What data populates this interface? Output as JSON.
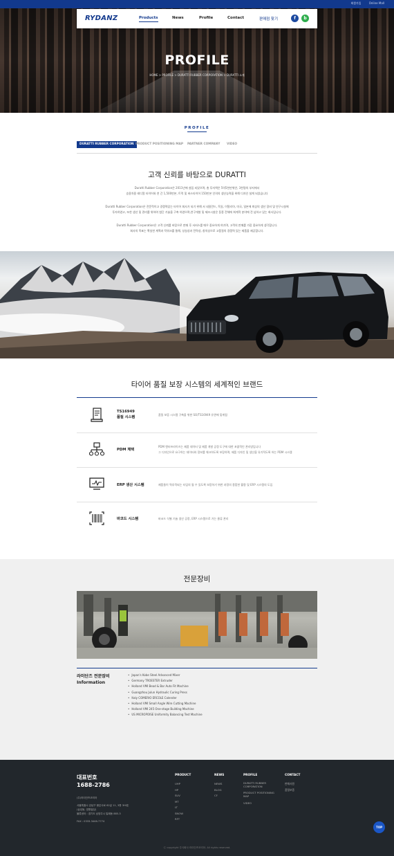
{
  "topbar": {
    "links": [
      "회원가입",
      "Online Mall"
    ]
  },
  "hero": {
    "title": "PROFILE",
    "breadcrumb": "HOME > PROFILE > DURATTI RUBBER CORPORATION > DURATTI 소개"
  },
  "nav": {
    "logo": "RYDANZ",
    "items": [
      "Products",
      "News",
      "Profile",
      "Contact"
    ],
    "agent": "판매점 찾기",
    "social": [
      "f",
      "b"
    ]
  },
  "profile": {
    "label": "PROFILE",
    "tabs": [
      "DURATTI RUBBER CORPORATION",
      "PRODUCT POSITIONING MAP",
      "PARTNER COMPANY",
      "VIDEO"
    ]
  },
  "intro": {
    "title": "고객 신뢰를 바탕으로 DURATTI",
    "p1": [
      "Duratti Rubber Corporation은 2011년에 설립 되었으며, 총 투자액은 5억5천만위안, 3천명의 부지에서",
      "승용차용 레디얼 타이어와 연 간 1,500만본, 트럭 및 버스타이어 150만본 인의의 생산능력을 위해 디자인 설계 되었습니다"
    ],
    "p2": [
      "Duratti Rubber Corporation은 전문적이고 경쟁력있는 타이어 회사가 되기 위해 서 네덜란드, 독일, 이탈리아, 미국, 일본에 최상의 생산 장비 및 연구시설에",
      "투자하였고, 또한 생산 및 관리를 위하여 첨단 기술을 구축 하였으며,연구개발 및 제조시설은 동종 전체에 최계적 분야에 전 넘하고 있는 회사입니다."
    ],
    "p3": [
      "Duratti Rubber Corporation은 고객 신뢰를 바탕으로 판매 후 서비스를 매우 중요하게 여기며, 고객의 판매를 가장 중요하게 생각합니다.",
      "회사의 목표는 확실한 계획과 탁워크를 통해, 성실성과 전략성, 창의성으로 고품질의 경쟁력 있는 제품을 제공합니다."
    ]
  },
  "brand": {
    "title": "타이어 품질 보장 시스템의 세계적인 브랜드",
    "features": [
      {
        "name": [
          "TS16949",
          "품질 시스템"
        ],
        "icon": "document-certificate-icon",
        "desc": [
          "품질 보증 시스템 구축을 위한 SO/TS16949 유관에 맞게됨"
        ]
      },
      {
        "name": [
          "PDM 체택"
        ],
        "icon": "network-hierarchy-icon",
        "desc": [
          "PDM 엔터프라이즈는 제품 데이터 및 제품 개발 공정 도구에 대한 포괄적인 관리방입니다",
          "그 디자인으로 요구하는 데이터와 정보를 체크하도록 보장하며, 제품 디자인 및 생산을 유기적도록 하는 PDM 시스템"
        ]
      },
      {
        "name": [
          "ERP 생산 시스템"
        ],
        "icon": "monitor-chart-icon",
        "desc": [
          "제품들이 역추적되는 타임의 될 수 있도록 보장하기 위한 과정의 종합한 활용 및 ERP 시스템의 도입"
        ]
      },
      {
        "name": [
          "바코드 시스템"
        ],
        "icon": "barcode-icon",
        "desc": [
          "바코드 식별 기술 생산 공정, ERP 시스템으로 가는 물류 관리"
        ]
      }
    ]
  },
  "equipment": {
    "title": "전문장비",
    "head": [
      "라이단즈 전문장비",
      "Information"
    ],
    "list": [
      "Japan's Kobe Steel Advanced Mixer",
      "Germany TROESTER Extruder",
      "Holland VMI Bead & Bar Auto Fit Machine",
      "Guangzhou Julun Hydraulic Curing Press",
      "Italy COMERIO ERCOLE Calender",
      "Holland VMI Small Angle Wire Cutting Machine",
      "Holland VMI 245 One-stage Building Machine",
      "US MICROPOISE Uniformity Balancing Test Machine"
    ]
  },
  "footer": {
    "phone_label": "대표번호",
    "phone": "1688-2786",
    "company": "(주)라이단즈코리아",
    "address": [
      "서울특별시 강남구 봉은사로 62길 11, 3층 3HI호",
      "(삼성동, 영원빌딩)",
      "물류센터 : 경기도 남양주시 일패동 885-3"
    ],
    "fax": "FAX : 0333-3446-7774",
    "columns": [
      {
        "head": "PRODUCT",
        "items": [
          "UHP",
          "HP",
          "SUV",
          "MT",
          "LT",
          "SNOW",
          "RFT"
        ]
      },
      {
        "head": "NEWS",
        "items": [
          "NEWS",
          "BLOG",
          "CF"
        ]
      },
      {
        "head": "PROFILE",
        "items": [
          "DURATTI RUBBER CORPORATION",
          "PRODUCT POSITIONING MAP",
          "VIDEO"
        ]
      },
      {
        "head": "CONTACT",
        "items": [
          "판매사원",
          "품질보증"
        ]
      }
    ],
    "copyright": "Ⓒ copyright 주식회사 라이단즈코리아. All rights reserved.",
    "top_button": "TOP"
  },
  "colors": {
    "brand": "#12398d",
    "footer": "#22272c",
    "top_button": "#1a56c6"
  }
}
